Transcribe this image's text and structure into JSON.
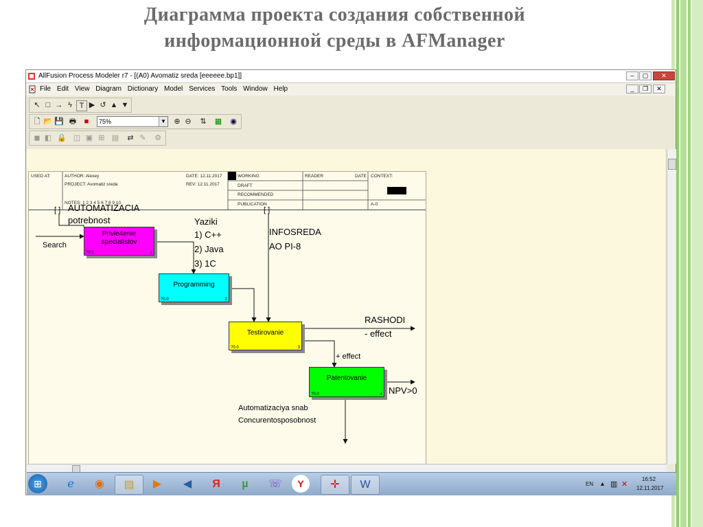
{
  "slide": {
    "title_line1": "Диаграмма проекта создания собственной",
    "title_line2": "информационной среды  в AFManager"
  },
  "window": {
    "title": "AllFusion Process Modeler r7 - [(A0)  Avomatiz sreda  [eeeeee.bp1]]",
    "menu": [
      "File",
      "Edit",
      "View",
      "Diagram",
      "Dictionary",
      "Model",
      "Services",
      "Tools",
      "Window",
      "Help"
    ],
    "zoom": "75%"
  },
  "header": {
    "used_at": "USED AT:",
    "author": "AUTHOR:  Alexey",
    "project": "PROJECT:  Avomatiz sreda",
    "date": "DATE:  12.11.2017",
    "rev": "REV:  12.11.2017",
    "notes": "NOTES:  1  2  3  4  5  6  7  8  9  10",
    "working": "WORKING",
    "draft": "DRAFT",
    "recommended": "RECOMMENDED",
    "publication": "PUBLICATION",
    "reader": "READER",
    "date2": "DATE",
    "context": "CONTEXT:",
    "node": "A-0"
  },
  "diagram": {
    "boxes": [
      {
        "label": "Privle4enie\nspecialistov",
        "num": "?0.0",
        "idx": "1",
        "color": "#ff00ff"
      },
      {
        "label": "Programming",
        "num": "?0.0",
        "idx": "2",
        "color": "#00ffff"
      },
      {
        "label": "Testirovanie",
        "num": "?0.0",
        "idx": "3",
        "color": "#ffff00"
      },
      {
        "label": "Patentovanie",
        "num": "?0.0",
        "idx": "4",
        "color": "#00ff00"
      }
    ],
    "labels": {
      "automatizacia": "AUTOMATIZACIA",
      "potrebnost": "potrebnost",
      "search": "Search",
      "yaziki": "Yaziki",
      "cpp": "1) C++",
      "java": "2) Java",
      "onec": "3) 1C",
      "infosreda": "INFOSREDA",
      "aopi": "AO PI-8",
      "rashodi": "RASHODI",
      "effect_out": "- effect",
      "plus_effect": "+ effect",
      "npv": "NPV>0",
      "auto_snab": "Automatizaciya snab",
      "concurent": "Concurentosposobnost",
      "tunnel1": "[ ]",
      "tunnel2": "[ ]"
    }
  },
  "taskbar": {
    "lang": "EN",
    "time": "16:52",
    "date": "12.11.2017"
  }
}
